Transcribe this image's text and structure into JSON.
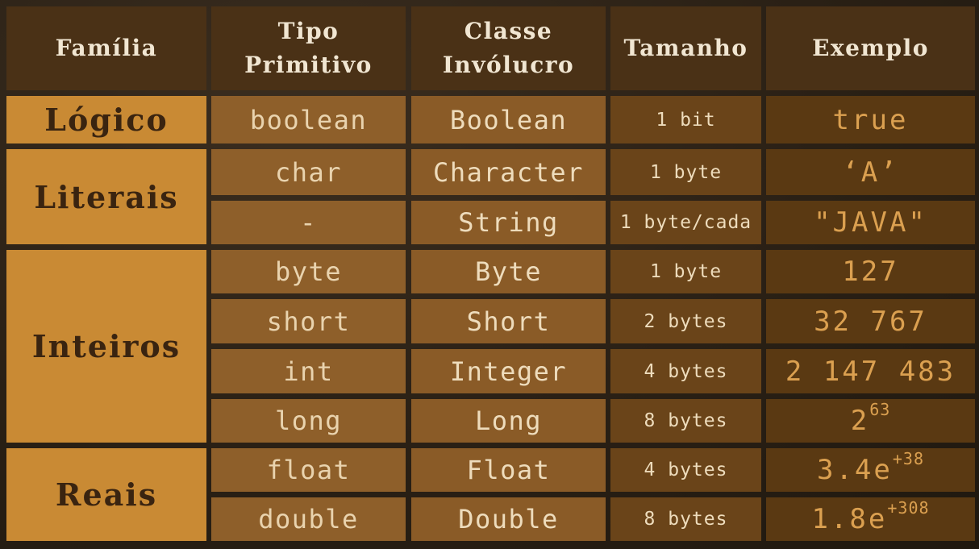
{
  "headers": {
    "familia": "Família",
    "tipo_line1": "Tipo",
    "tipo_line2": "Primitivo",
    "classe_line1": "Classe",
    "classe_line2": "Invólucro",
    "tamanho": "Tamanho",
    "exemplo": "Exemplo"
  },
  "families": {
    "logico": "Lógico",
    "literais": "Literais",
    "inteiros": "Inteiros",
    "reais": "Reais"
  },
  "rows": [
    {
      "primitivo": "boolean",
      "involucro": "Boolean",
      "tamanho": "1 bit",
      "exemplo": "true"
    },
    {
      "primitivo": "char",
      "involucro": "Character",
      "tamanho": "1 byte",
      "exemplo": "‘A’"
    },
    {
      "primitivo": "-",
      "involucro": "String",
      "tamanho": "1 byte/cada",
      "exemplo": "\"JAVA\""
    },
    {
      "primitivo": "byte",
      "involucro": "Byte",
      "tamanho": "1 byte",
      "exemplo": "127"
    },
    {
      "primitivo": "short",
      "involucro": "Short",
      "tamanho": "2 bytes",
      "exemplo": "32 767"
    },
    {
      "primitivo": "int",
      "involucro": "Integer",
      "tamanho": "4 bytes",
      "exemplo": "2 147 483"
    },
    {
      "primitivo": "long",
      "involucro": "Long",
      "tamanho": "8 bytes",
      "exemplo_base": "2",
      "exemplo_exp": "63"
    },
    {
      "primitivo": "float",
      "involucro": "Float",
      "tamanho": "4 bytes",
      "exemplo_base": "3.4e",
      "exemplo_exp": "+38"
    },
    {
      "primitivo": "double",
      "involucro": "Double",
      "tamanho": "8 bytes",
      "exemplo_base": "1.8e",
      "exemplo_exp": "+308"
    }
  ],
  "colors": {
    "background": "#2b2116",
    "header": "#4a3116",
    "family": "#c98a34",
    "primitive": "#8e5f2a",
    "wrapper": "#8a5b27",
    "size": "#6a4419",
    "example": "#5a3912",
    "example_text": "#dba050"
  }
}
